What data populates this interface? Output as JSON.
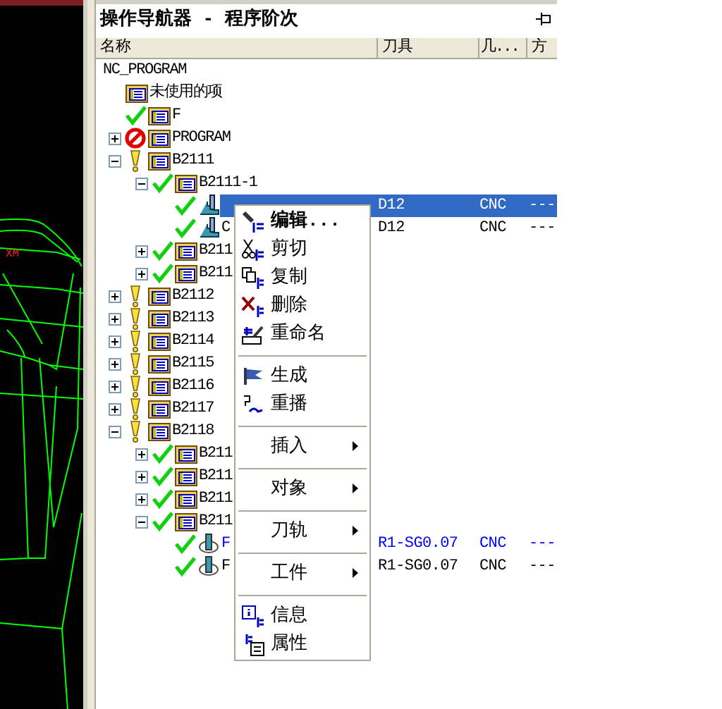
{
  "viewport": {
    "label": "XM"
  },
  "panel": {
    "title": "操作导航器 - 程序阶次",
    "columns": [
      "名称",
      "刀具",
      "几...",
      "方"
    ]
  },
  "tree": [
    {
      "name": "NC_PROGRAM",
      "kind": "root",
      "selected": false,
      "children": [
        {
          "name": "未使用的项",
          "kind": "program",
          "selected": false
        },
        {
          "name": "F",
          "kind": "complete-program",
          "selected": false
        },
        {
          "name": "PROGRAM",
          "kind": "blocked-program",
          "expanded": false,
          "selected": false
        },
        {
          "name": "B2111",
          "kind": "warning-program",
          "expanded": true,
          "selected": false,
          "children": [
            {
              "name": "B2111-1",
              "kind": "complete-program",
              "expanded": true,
              "selected": false,
              "children": [
                {
                  "kind": "stepped-operation",
                  "tool": "D12",
                  "geometry": "CNC",
                  "method": "---",
                  "highlighted": false,
                  "selected": true
                },
                {
                  "name": "C",
                  "kind": "stepped-operation",
                  "tool": "D12",
                  "geometry": "CNC",
                  "method": "---",
                  "highlighted": false,
                  "selected": false
                }
              ]
            },
            {
              "name": "B211",
              "kind": "complete-program",
              "expanded": false,
              "selected": false
            },
            {
              "name": "B211",
              "kind": "complete-program",
              "expanded": false,
              "selected": false
            }
          ]
        },
        {
          "name": "B2112",
          "kind": "warning-program",
          "expanded": false,
          "selected": false
        },
        {
          "name": "B2113",
          "kind": "warning-program",
          "expanded": false,
          "selected": false
        },
        {
          "name": "B2114",
          "kind": "warning-program",
          "expanded": false,
          "selected": false
        },
        {
          "name": "B2115",
          "kind": "warning-program",
          "expanded": false,
          "selected": false
        },
        {
          "name": "B2116",
          "kind": "warning-program",
          "expanded": false,
          "selected": false
        },
        {
          "name": "B2117",
          "kind": "warning-program",
          "expanded": false,
          "selected": false
        },
        {
          "name": "B2118",
          "kind": "warning-program",
          "expanded": true,
          "selected": false,
          "children": [
            {
              "name": "B211",
              "kind": "complete-program",
              "expanded": false,
              "selected": false
            },
            {
              "name": "B211",
              "kind": "complete-program",
              "expanded": false,
              "selected": false
            },
            {
              "name": "B211",
              "kind": "complete-program",
              "expanded": false,
              "selected": false
            },
            {
              "name": "B211",
              "kind": "complete-program",
              "expanded": true,
              "selected": false,
              "children": [
                {
                  "name": "F",
                  "kind": "ring-operation",
                  "tool": "R1-SG0.07",
                  "geometry": "CNC",
                  "method": "---",
                  "highlighted": true,
                  "selected": false
                },
                {
                  "name": "F",
                  "kind": "ring-operation",
                  "tool": "R1-SG0.07",
                  "geometry": "CNC",
                  "method": "---",
                  "highlighted": false,
                  "selected": false
                }
              ]
            }
          ]
        }
      ]
    }
  ],
  "context_menu": [
    {
      "kind": "command",
      "label": "编辑...",
      "default": true
    },
    {
      "kind": "command",
      "label": "剪切",
      "default": false
    },
    {
      "kind": "command",
      "label": "复制",
      "default": false
    },
    {
      "kind": "command",
      "label": "删除",
      "default": false
    },
    {
      "kind": "command",
      "label": "重命名",
      "default": false
    },
    {
      "kind": "separator"
    },
    {
      "kind": "command",
      "label": "生成",
      "default": false
    },
    {
      "kind": "command",
      "label": "重播",
      "default": false
    },
    {
      "kind": "separator"
    },
    {
      "kind": "submenu",
      "label": "插入"
    },
    {
      "kind": "separator"
    },
    {
      "kind": "submenu",
      "label": "对象"
    },
    {
      "kind": "separator"
    },
    {
      "kind": "submenu",
      "label": "刀轨"
    },
    {
      "kind": "separator"
    },
    {
      "kind": "submenu",
      "label": "工件"
    },
    {
      "kind": "separator"
    },
    {
      "kind": "command",
      "label": "信息",
      "default": false
    },
    {
      "kind": "command",
      "label": "属性",
      "default": false
    }
  ]
}
